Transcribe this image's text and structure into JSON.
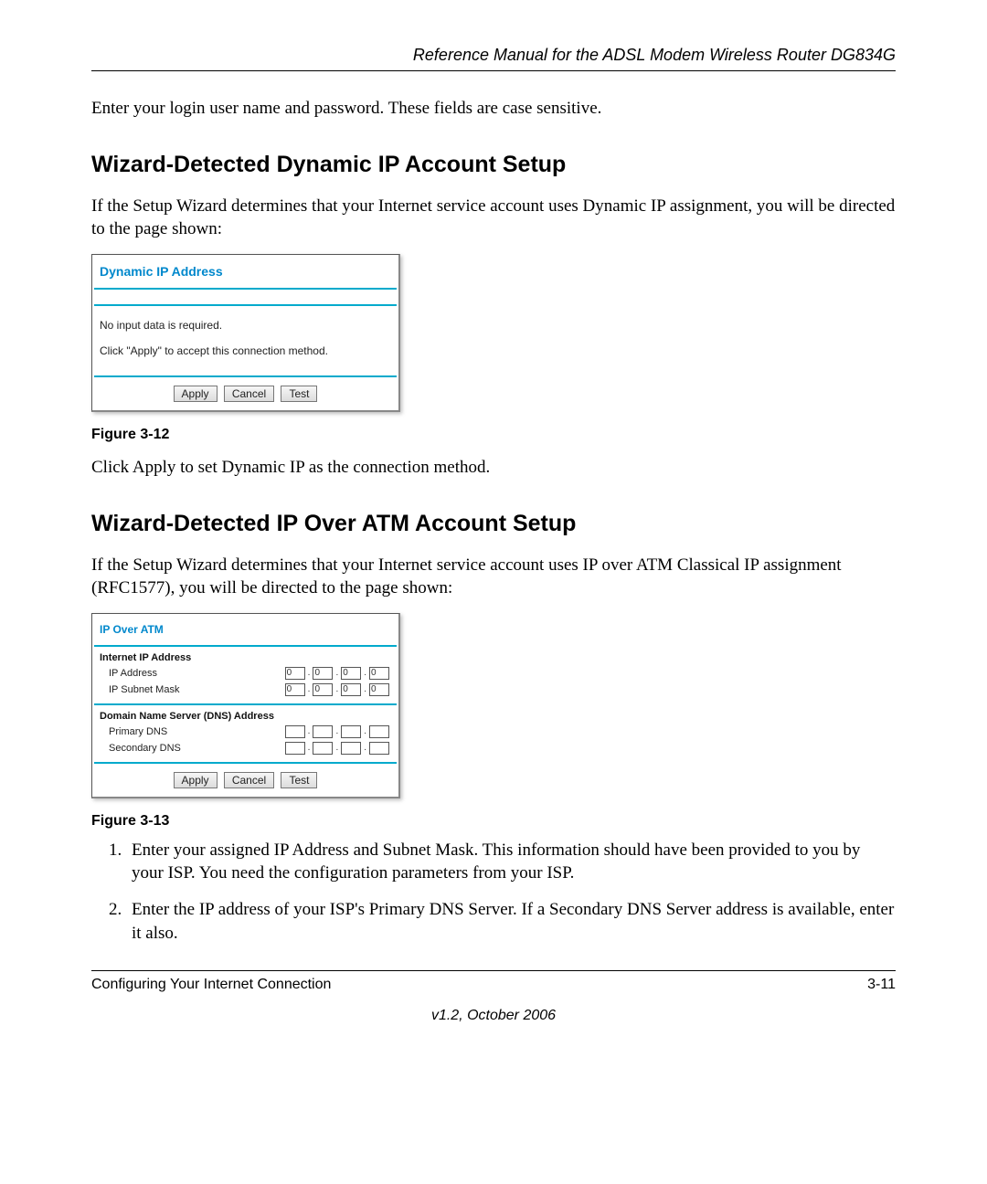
{
  "header": {
    "title": "Reference Manual for the ADSL Modem Wireless Router DG834G"
  },
  "intro_text": "Enter your login user name and password. These fields are case sensitive.",
  "section1": {
    "heading": "Wizard-Detected Dynamic IP Account Setup",
    "para": "If the Setup Wizard determines that your Internet service account uses Dynamic IP assignment, you will be directed to the page shown:",
    "figure": {
      "title": "Dynamic IP Address",
      "line1": "No input data is required.",
      "line2": "Click \"Apply\" to accept this connection method.",
      "buttons": {
        "apply": "Apply",
        "cancel": "Cancel",
        "test": "Test"
      },
      "caption": "Figure 3-12"
    },
    "after": "Click Apply to set Dynamic IP as the connection method."
  },
  "section2": {
    "heading": "Wizard-Detected IP Over ATM Account Setup",
    "para": "If the Setup Wizard determines that your Internet service account uses IP over ATM Classical IP assignment (RFC1577), you will be directed to the page shown:",
    "figure": {
      "title": "IP Over ATM",
      "group1_label": "Internet IP Address",
      "ip_label": "IP Address",
      "ip_values": [
        "0",
        "0",
        "0",
        "0"
      ],
      "mask_label": "IP Subnet Mask",
      "mask_values": [
        "0",
        "0",
        "0",
        "0"
      ],
      "group2_label": "Domain Name Server (DNS) Address",
      "primary_label": "Primary DNS",
      "primary_values": [
        "",
        "",
        "",
        ""
      ],
      "secondary_label": "Secondary DNS",
      "secondary_values": [
        "",
        "",
        "",
        ""
      ],
      "buttons": {
        "apply": "Apply",
        "cancel": "Cancel",
        "test": "Test"
      },
      "caption": "Figure 3-13"
    },
    "steps": [
      "Enter your assigned IP Address and Subnet Mask. This information should have been provided to you by your ISP. You need the configuration parameters from your ISP.",
      "Enter the IP address of your ISP's Primary DNS Server. If a Secondary DNS Server address is available, enter it also."
    ]
  },
  "footer": {
    "left": "Configuring Your Internet Connection",
    "right": "3-11",
    "version": "v1.2, October 2006"
  }
}
